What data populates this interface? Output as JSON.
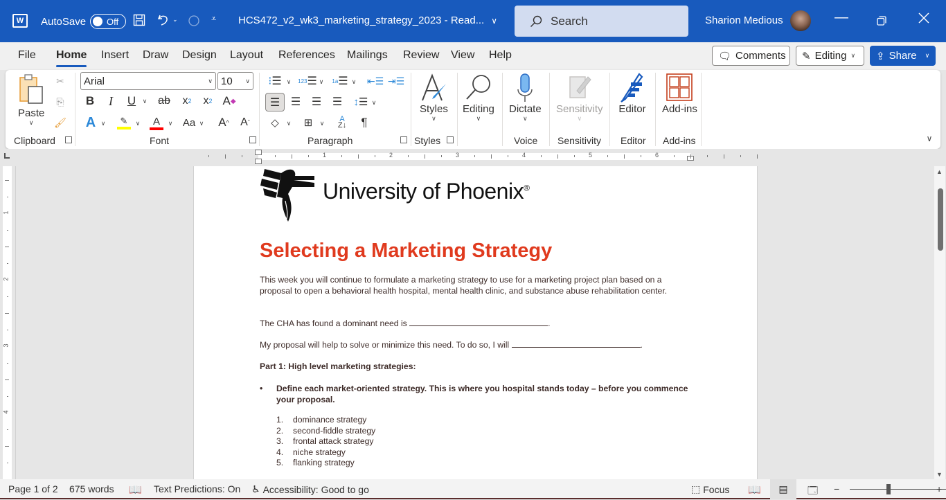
{
  "titlebar": {
    "app_icon": "word-icon",
    "autosave_label": "AutoSave",
    "autosave_state": "Off",
    "document_title": "HCS472_v2_wk3_marketing_strategy_2023  -  Read...",
    "search_placeholder": "Search",
    "user_name": "Sharion Medious",
    "icons": [
      "save-icon",
      "undo-icon",
      "redo-icon",
      "customize-quick-access-icon"
    ]
  },
  "menu": {
    "tabs": [
      "File",
      "Home",
      "Insert",
      "Draw",
      "Design",
      "Layout",
      "References",
      "Mailings",
      "Review",
      "View",
      "Help"
    ],
    "active_tab": "Home",
    "comments_label": "Comments",
    "editing_label": "Editing",
    "share_label": "Share"
  },
  "ribbon": {
    "clipboard": {
      "paste_label": "Paste",
      "group_label": "Clipboard"
    },
    "font": {
      "font_name": "Arial",
      "font_size": "10",
      "group_label": "Font",
      "highlight_color": "#ffff00",
      "font_color": "#ff0000"
    },
    "paragraph": {
      "group_label": "Paragraph"
    },
    "styles": {
      "label": "Styles",
      "group_label": "Styles"
    },
    "editing": {
      "label": "Editing"
    },
    "voice": {
      "label": "Dictate",
      "group_label": "Voice"
    },
    "sensitivity": {
      "label": "Sensitivity",
      "group_label": "Sensitivity"
    },
    "editor": {
      "label": "Editor",
      "group_label": "Editor"
    },
    "addins": {
      "label": "Add-ins",
      "group_label": "Add-ins"
    }
  },
  "ruler": {
    "h_numbers": [
      "1",
      "2",
      "3",
      "4",
      "5",
      "6"
    ],
    "v_numbers": [
      "1",
      "2",
      "3",
      "4"
    ]
  },
  "document": {
    "logo_text": "University of Phoenix",
    "logo_mark": "®",
    "title": "Selecting a Marketing Strategy",
    "intro": "This week you will continue to formulate a marketing strategy to use for a marketing project plan based on a proposal to open a behavioral health hospital, mental health clinic, and substance abuse rehabilitation center.",
    "need_sentence": "The CHA has found a dominant need is",
    "proposal_sentence": "My proposal will help to solve or minimize this need.  To do so, I will",
    "part1_heading": "Part 1: High level marketing strategies:",
    "bullet": "Define each market-oriented strategy.  This is where you hospital stands today – before you commence your proposal.",
    "strategies": [
      {
        "num": "1.",
        "text": "dominance strategy"
      },
      {
        "num": "2.",
        "text": "second-fiddle strategy"
      },
      {
        "num": "3.",
        "text": "frontal attack strategy"
      },
      {
        "num": "4.",
        "text": "niche strategy"
      },
      {
        "num": "5.",
        "text": "flanking strategy"
      }
    ],
    "title_color": "#e03a1e"
  },
  "status": {
    "page": "Page 1 of 2",
    "words": "675 words",
    "text_predictions": "Text Predictions: On",
    "accessibility": "Accessibility: Good to go",
    "focus": "Focus"
  },
  "colors": {
    "brand": "#185abd"
  }
}
